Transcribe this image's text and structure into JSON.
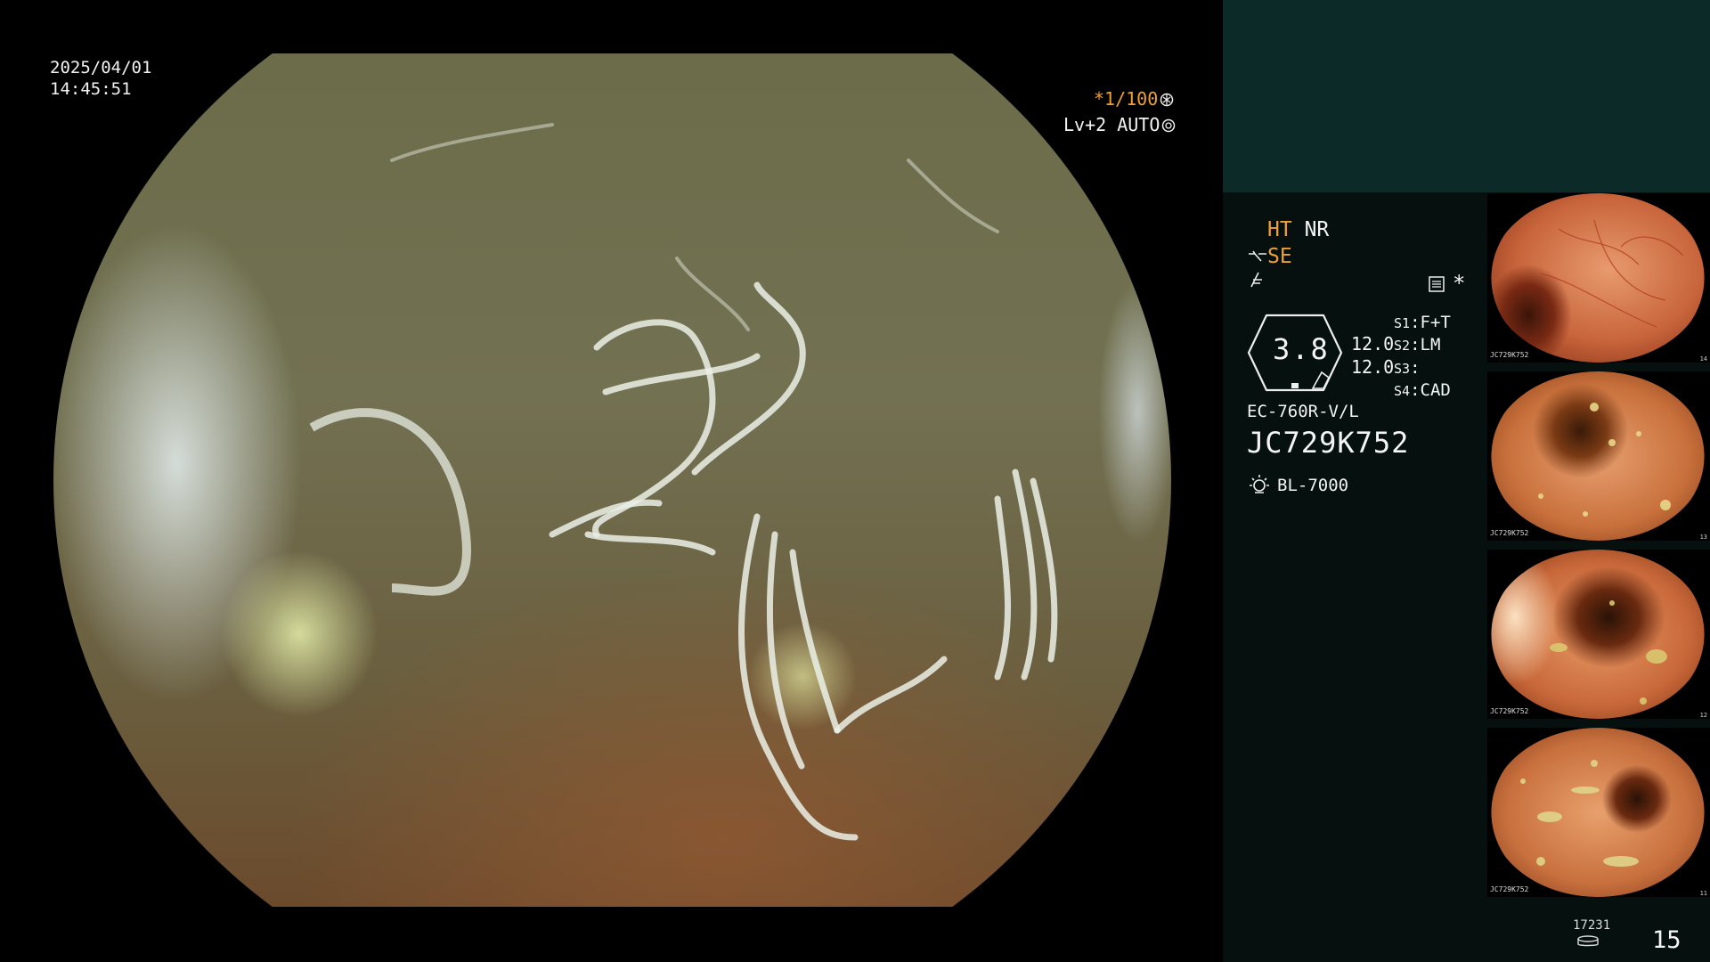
{
  "overlay": {
    "date": "2025/04/01",
    "time": "14:45:51",
    "shutter": "*1/100",
    "level": "Lv+2 AUTO"
  },
  "panel": {
    "ht": "HT",
    "nr": "NR",
    "se": "SE",
    "star": "*",
    "gauge_value": "3.8",
    "val1": "12.0",
    "val2": "12.0",
    "s1_label": "S1",
    "s1_value": ":F+T",
    "s2_label": "S2",
    "s2_value": ":LM",
    "s3_label": "S3",
    "s3_value": ":",
    "s4_label": "S4",
    "s4_value": ":CAD",
    "scope_model": "EC-760R-V/L",
    "serial": "JC729K752",
    "light_source": "BL-7000",
    "counter": "17231",
    "page": "15"
  },
  "thumbnails": [
    {
      "label": "JC729K752",
      "number": "14"
    },
    {
      "label": "JC729K752",
      "number": "13"
    },
    {
      "label": "JC729K752",
      "number": "12"
    },
    {
      "label": "JC729K752",
      "number": "11"
    }
  ],
  "colors": {
    "accent": "#f0a030",
    "panel_bg": "#06110f",
    "panel_top": "#0b2a28"
  }
}
